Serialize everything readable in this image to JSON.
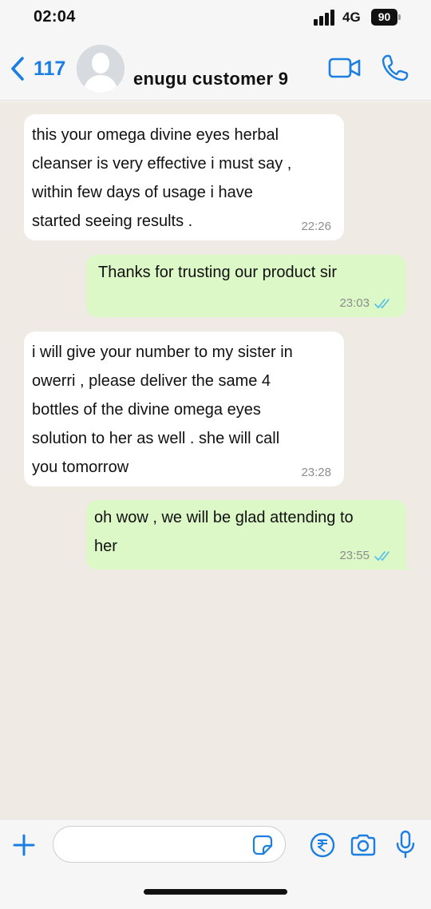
{
  "status_bar": {
    "time": "02:04",
    "network": "4G",
    "battery": "90"
  },
  "header": {
    "back_count": "117",
    "contact_name": "enugu customer 9",
    "accent_color": "#1a7ee3"
  },
  "messages": [
    {
      "direction": "incoming",
      "text": " this your omega divine eyes herbal\ncleanser is very effective i must say ,\nwithin few days of usage i have\nstarted seeing results .",
      "time": "22:26"
    },
    {
      "direction": "outgoing",
      "text": "Thanks for trusting our product sir",
      "time": "23:03",
      "status": "read"
    },
    {
      "direction": "incoming",
      "text": " i will give your number to my sister in\nowerri , please deliver the same 4\nbottles of the divine omega eyes\nsolution to her as well . she will call\nyou tomorrow",
      "time": "23:28"
    },
    {
      "direction": "outgoing",
      "text": " oh wow , we will be glad attending to\nher",
      "time": "23:55",
      "status": "read"
    }
  ],
  "composer": {
    "value": "",
    "placeholder": ""
  },
  "icons": {
    "back": "chevron-left-icon",
    "video": "video-camera-icon",
    "call": "phone-icon",
    "plus": "plus-icon",
    "sticker": "sticker-icon",
    "payment": "rupee-payment-icon",
    "camera": "camera-icon",
    "mic": "microphone-icon"
  },
  "colors": {
    "incoming_bubble": "#ffffff",
    "outgoing_bubble": "#dcf8c6",
    "chat_background": "#efebe4",
    "read_ticks": "#53bdeb"
  }
}
